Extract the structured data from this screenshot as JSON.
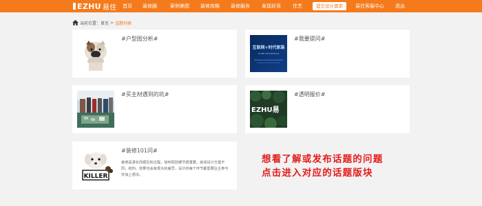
{
  "header": {
    "logo_text": "EZHU",
    "logo_cn": "易住",
    "nav": [
      "首页",
      "装修圈",
      "案例美图",
      "装修攻略",
      "装修服务",
      "发现好货",
      "住艺"
    ],
    "cta_label": "提交设计需求",
    "right_links": [
      "易住客服中心",
      "退出"
    ],
    "accent": "#f47a1b"
  },
  "breadcrumb": {
    "label": "当前位置：",
    "home": "首页",
    "separator": ">",
    "current": "话题列表"
  },
  "topics": [
    {
      "title": "#户型图分析#",
      "image": "bulldog-photo",
      "description": ""
    },
    {
      "title": "#我要提问#",
      "image": "blue-banner-image",
      "banner_text": "互联网+时代家装",
      "banner_sub": "HOME DECORATION",
      "description": ""
    },
    {
      "title": "#买主材遇到的坑#",
      "image": "showroom-photo",
      "description": ""
    },
    {
      "title": "#透明报价#",
      "image": "ezhu-logo-wall",
      "logo_text": "EZHU易",
      "description": ""
    },
    {
      "title": "#装修101问#",
      "image": "killer-puppy-photo",
      "description": "装修是漫长而艰巨的过程，如何把控细节很重要。房间设计方案不同，结构、效果也会有很大的差异，设计的每个环节都需要业主参与并加上想法。"
    }
  ],
  "promo": {
    "line1": "想看了解或发布话题的问题",
    "line2": "点击进入对应的话题版块",
    "color": "#e41b1b"
  }
}
